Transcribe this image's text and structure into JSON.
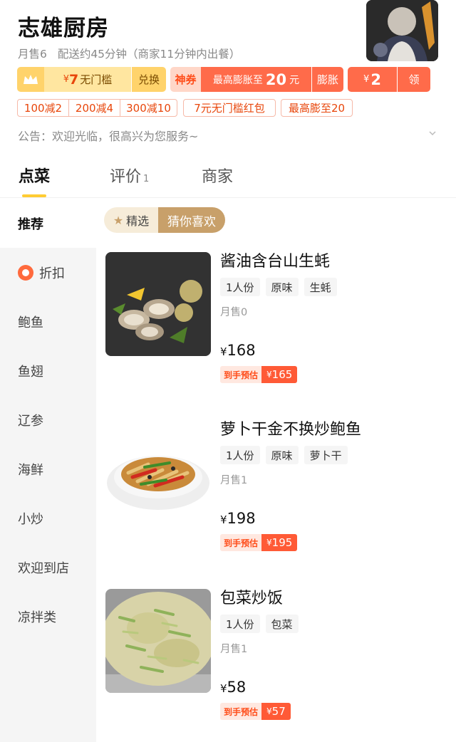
{
  "store": {
    "name": "志雄厨房",
    "monthly_sales": "月售6",
    "delivery": "配送约45分钟（商家11分钟内出餐）"
  },
  "coupons": {
    "vip_yen": "¥",
    "vip_amount": "7",
    "vip_label": "无门槛",
    "exchange": "兑换",
    "shen_label": "神券",
    "max_expand_prefix": "最高膨胀至",
    "max_expand_amount": "20",
    "max_expand_unit": "元",
    "expand": "膨胀",
    "small_yen": "¥",
    "small_amount": "2",
    "take": "领"
  },
  "discounts": [
    "100减2",
    "200减4",
    "300减10",
    "7元无门槛红包",
    "最高膨至20"
  ],
  "notice": "公告：欢迎光临，很高兴为您服务~",
  "tabs": [
    {
      "label": "点菜"
    },
    {
      "label": "评价",
      "count": "1"
    },
    {
      "label": "商家"
    }
  ],
  "sidebar": {
    "items": [
      {
        "label": "推荐"
      },
      {
        "label": "折扣"
      },
      {
        "label": "鲍鱼"
      },
      {
        "label": "鱼翅"
      },
      {
        "label": "辽参"
      },
      {
        "label": "海鲜"
      },
      {
        "label": "小炒"
      },
      {
        "label": "欢迎到店"
      },
      {
        "label": "凉拌类"
      }
    ]
  },
  "section": {
    "tag_star": "精选",
    "tag_guess": "猜你喜欢"
  },
  "dishes": [
    {
      "name": "酱油含台山生蚝",
      "tags": [
        "1人份",
        "原味",
        "生蚝"
      ],
      "sold": "月售0",
      "yen": "¥",
      "price": "168",
      "est_label": "到手预估",
      "est_yen": "¥",
      "est_price": "165"
    },
    {
      "name": "萝卜干金不换炒鲍鱼",
      "tags": [
        "1人份",
        "原味",
        "萝卜干"
      ],
      "sold": "月售1",
      "yen": "¥",
      "price": "198",
      "est_label": "到手预估",
      "est_yen": "¥",
      "est_price": "195"
    },
    {
      "name": "包菜炒饭",
      "tags": [
        "1人份",
        "包菜"
      ],
      "sold": "月售1",
      "yen": "¥",
      "price": "58",
      "est_label": "到手预估",
      "est_yen": "¥",
      "est_price": "57"
    }
  ],
  "colors": {
    "accent_orange": "#ff5a36",
    "vip_gold": "#ffd36b",
    "tab_underline": "#ffcc33",
    "section_tag": "#c8a06a"
  }
}
